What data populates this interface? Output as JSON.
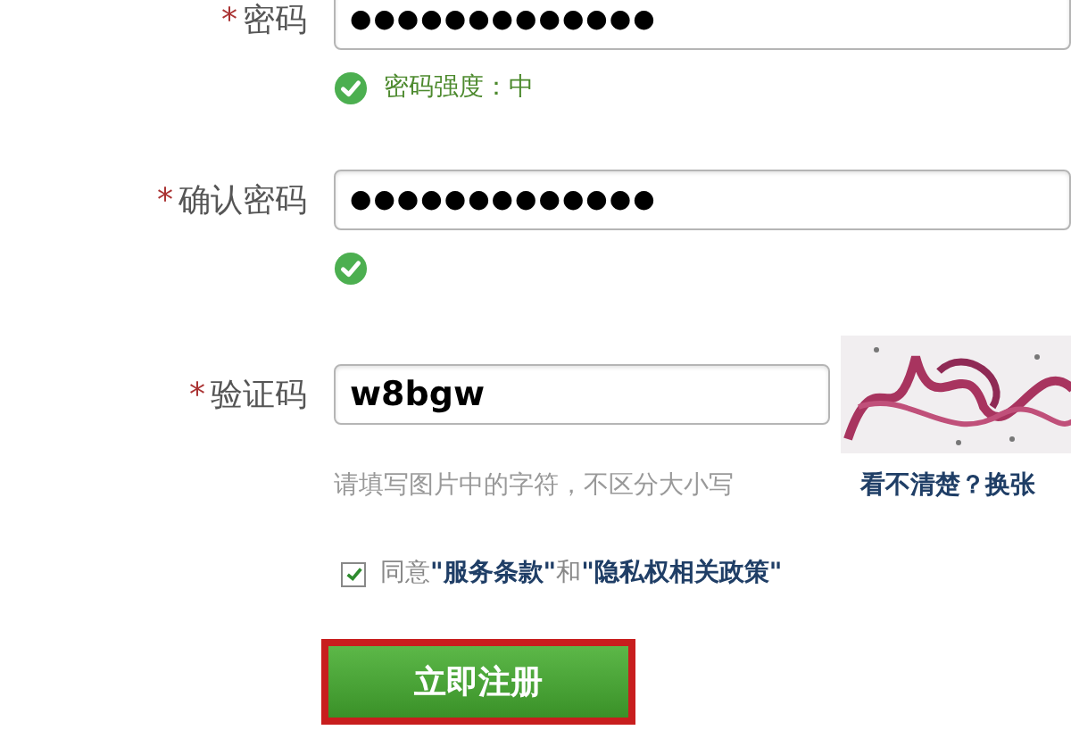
{
  "fields": [
    {
      "kind": "password",
      "required_mark": "*",
      "label": "密码",
      "value": "●●●●●●●●●●●●●",
      "status": {
        "valid": true,
        "message": "密码强度：中"
      }
    },
    {
      "kind": "password",
      "required_mark": "*",
      "label": "确认密码",
      "value": "●●●●●●●●●●●●●",
      "status": {
        "valid": true
      }
    },
    {
      "kind": "captcha",
      "required_mark": "*",
      "label": "验证码",
      "value": "w8bgw",
      "hint": "请填写图片中的字符，不区分大小写",
      "refresh_link": "看不清楚？换张"
    }
  ],
  "agreement": {
    "checked": true,
    "parts": [
      {
        "kind": "text",
        "text": "同意"
      },
      {
        "kind": "link",
        "text": "\"服务条款\""
      },
      {
        "kind": "text",
        "text": "和"
      },
      {
        "kind": "link",
        "text": "\"隐私权相关政策\""
      }
    ]
  },
  "submit_button": {
    "label": "立即注册",
    "focused": true
  }
}
